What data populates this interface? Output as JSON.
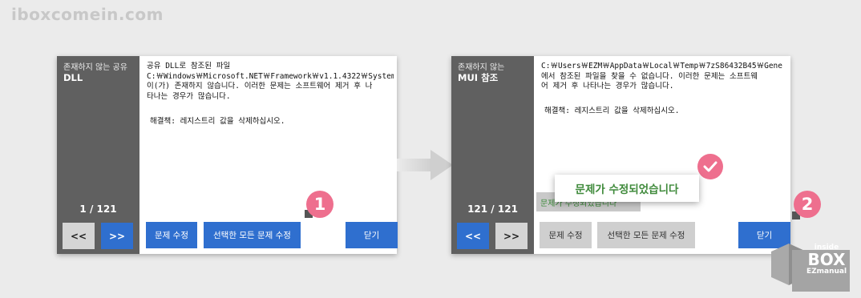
{
  "watermark": "iboxcomein.com",
  "dialog_before": {
    "category_line1": "존재하지 않는 공유",
    "category_line2": "DLL",
    "counter": "1 / 121",
    "prev_label": "<<",
    "next_label": ">>",
    "lines": [
      "공유 DLL로 참조된 파일",
      "C:￦Windows￦Microsoft.NET￦Framework￦v1.1.4322￦System",
      "이(가) 존재하지 않습니다. 이러한 문제는 소프트웨어 제거 후 나",
      "타나는 경우가 많습니다."
    ],
    "solution": "해결책: 레지스트리 값을 삭제하십시오.",
    "fix_label": "문제 수정",
    "fix_all_label": "선택한 모든 문제 수정",
    "close_label": "닫기"
  },
  "dialog_after": {
    "category_line1": "존재하지 않는",
    "category_line2": "MUI 참조",
    "counter": "121 / 121",
    "prev_label": "<<",
    "next_label": ">>",
    "lines": [
      "C:￦Users￦EZM￦AppData￦Local￦Temp￦7zS86432B45￦Gene",
      "에서 참조된 파일을 찾을 수 없습니다. 이러한 문제는 소프트웨",
      "어 제거 후 나타나는 경우가 많습니다."
    ],
    "solution": "해결책: 레지스트리 값을 삭제하십시오.",
    "fixed_popup": "문제가 수정되었습니다",
    "fixed_under": "문제가 수정되었습니다",
    "fix_label": "문제 수정",
    "fix_all_label": "선택한 모든 문제 수정",
    "close_label": "닫기"
  },
  "badges": {
    "first": "1",
    "second": "2"
  },
  "logo": {
    "line1": "inside",
    "line2": "BOX",
    "line3": "EZmanual"
  },
  "colors": {
    "accent_blue": "#2f6fcf",
    "badge_pink": "#ee6f8e",
    "sidebar": "#606060",
    "success_green": "#3f8a3b"
  }
}
